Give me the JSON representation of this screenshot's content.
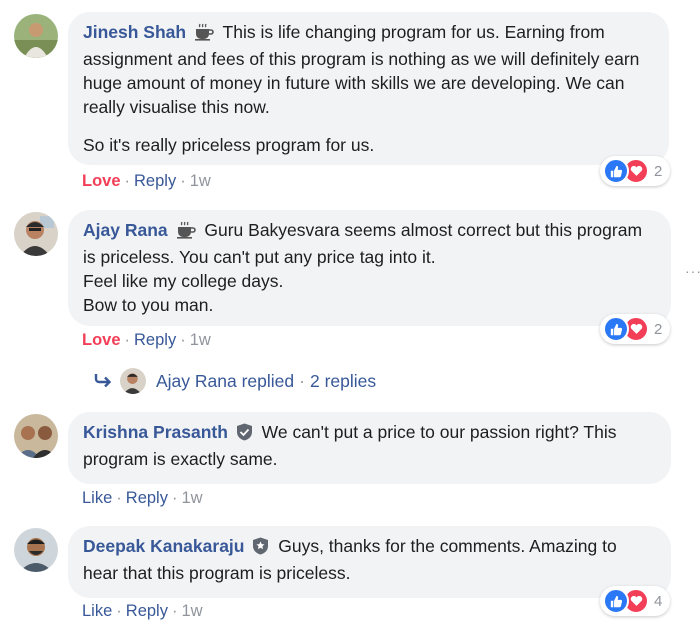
{
  "comments": [
    {
      "author": "Jinesh Shah",
      "badge": "coffee-cup-icon",
      "text": "This is life changing program for us. Earning from assignment and fees of this program is nothing as we will definitely earn huge amount of money in future with skills we are developing. We can really visualise this now.",
      "text2": "So it's really priceless program for us.",
      "action1": "Love",
      "action2": "Reply",
      "time": "1w",
      "reactions": "2"
    },
    {
      "author": "Ajay Rana",
      "badge": "coffee-cup-icon",
      "text_lines": [
        "Guru Bakyesvara seems almost correct but this program is priceless. You can't put any price tag into it.",
        "Feel like my college days.",
        "Bow to you man."
      ],
      "action1": "Love",
      "action2": "Reply",
      "time": "1w",
      "reactions": "2",
      "replies_text": "Ajay Rana replied",
      "replies_count": "2 replies"
    },
    {
      "author": "Krishna Prasanth",
      "badge": "shield-check-icon",
      "text": "We can't put a price to our passion right? This program is exactly same.",
      "action1": "Like",
      "action2": "Reply",
      "time": "1w"
    },
    {
      "author": "Deepak Kanakaraju",
      "badge": "shield-star-icon",
      "text": "Guys, thanks for the comments. Amazing to hear that this program is priceless.",
      "action1": "Like",
      "action2": "Reply",
      "time": "1w",
      "reactions": "4"
    }
  ],
  "colors": {
    "link": "#385898",
    "love": "#f33e58",
    "like_blue": "#2a78f5",
    "bubble": "#f2f3f5",
    "muted": "#90949c"
  }
}
